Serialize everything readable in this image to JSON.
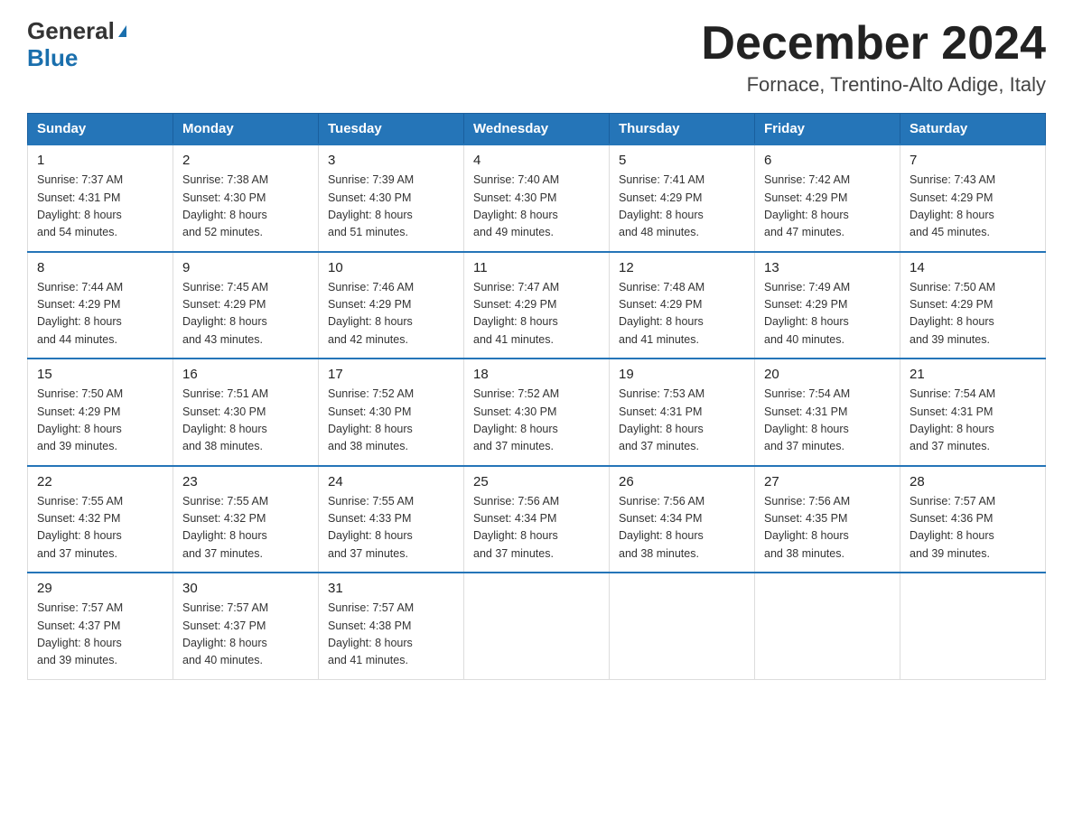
{
  "logo": {
    "line1": "General",
    "arrow": "▶",
    "line2": "Blue"
  },
  "title": {
    "month_year": "December 2024",
    "location": "Fornace, Trentino-Alto Adige, Italy"
  },
  "weekdays": [
    "Sunday",
    "Monday",
    "Tuesday",
    "Wednesday",
    "Thursday",
    "Friday",
    "Saturday"
  ],
  "weeks": [
    [
      {
        "day": "1",
        "sunrise": "7:37 AM",
        "sunset": "4:31 PM",
        "daylight": "8 hours and 54 minutes."
      },
      {
        "day": "2",
        "sunrise": "7:38 AM",
        "sunset": "4:30 PM",
        "daylight": "8 hours and 52 minutes."
      },
      {
        "day": "3",
        "sunrise": "7:39 AM",
        "sunset": "4:30 PM",
        "daylight": "8 hours and 51 minutes."
      },
      {
        "day": "4",
        "sunrise": "7:40 AM",
        "sunset": "4:30 PM",
        "daylight": "8 hours and 49 minutes."
      },
      {
        "day": "5",
        "sunrise": "7:41 AM",
        "sunset": "4:29 PM",
        "daylight": "8 hours and 48 minutes."
      },
      {
        "day": "6",
        "sunrise": "7:42 AM",
        "sunset": "4:29 PM",
        "daylight": "8 hours and 47 minutes."
      },
      {
        "day": "7",
        "sunrise": "7:43 AM",
        "sunset": "4:29 PM",
        "daylight": "8 hours and 45 minutes."
      }
    ],
    [
      {
        "day": "8",
        "sunrise": "7:44 AM",
        "sunset": "4:29 PM",
        "daylight": "8 hours and 44 minutes."
      },
      {
        "day": "9",
        "sunrise": "7:45 AM",
        "sunset": "4:29 PM",
        "daylight": "8 hours and 43 minutes."
      },
      {
        "day": "10",
        "sunrise": "7:46 AM",
        "sunset": "4:29 PM",
        "daylight": "8 hours and 42 minutes."
      },
      {
        "day": "11",
        "sunrise": "7:47 AM",
        "sunset": "4:29 PM",
        "daylight": "8 hours and 41 minutes."
      },
      {
        "day": "12",
        "sunrise": "7:48 AM",
        "sunset": "4:29 PM",
        "daylight": "8 hours and 41 minutes."
      },
      {
        "day": "13",
        "sunrise": "7:49 AM",
        "sunset": "4:29 PM",
        "daylight": "8 hours and 40 minutes."
      },
      {
        "day": "14",
        "sunrise": "7:50 AM",
        "sunset": "4:29 PM",
        "daylight": "8 hours and 39 minutes."
      }
    ],
    [
      {
        "day": "15",
        "sunrise": "7:50 AM",
        "sunset": "4:29 PM",
        "daylight": "8 hours and 39 minutes."
      },
      {
        "day": "16",
        "sunrise": "7:51 AM",
        "sunset": "4:30 PM",
        "daylight": "8 hours and 38 minutes."
      },
      {
        "day": "17",
        "sunrise": "7:52 AM",
        "sunset": "4:30 PM",
        "daylight": "8 hours and 38 minutes."
      },
      {
        "day": "18",
        "sunrise": "7:52 AM",
        "sunset": "4:30 PM",
        "daylight": "8 hours and 37 minutes."
      },
      {
        "day": "19",
        "sunrise": "7:53 AM",
        "sunset": "4:31 PM",
        "daylight": "8 hours and 37 minutes."
      },
      {
        "day": "20",
        "sunrise": "7:54 AM",
        "sunset": "4:31 PM",
        "daylight": "8 hours and 37 minutes."
      },
      {
        "day": "21",
        "sunrise": "7:54 AM",
        "sunset": "4:31 PM",
        "daylight": "8 hours and 37 minutes."
      }
    ],
    [
      {
        "day": "22",
        "sunrise": "7:55 AM",
        "sunset": "4:32 PM",
        "daylight": "8 hours and 37 minutes."
      },
      {
        "day": "23",
        "sunrise": "7:55 AM",
        "sunset": "4:32 PM",
        "daylight": "8 hours and 37 minutes."
      },
      {
        "day": "24",
        "sunrise": "7:55 AM",
        "sunset": "4:33 PM",
        "daylight": "8 hours and 37 minutes."
      },
      {
        "day": "25",
        "sunrise": "7:56 AM",
        "sunset": "4:34 PM",
        "daylight": "8 hours and 37 minutes."
      },
      {
        "day": "26",
        "sunrise": "7:56 AM",
        "sunset": "4:34 PM",
        "daylight": "8 hours and 38 minutes."
      },
      {
        "day": "27",
        "sunrise": "7:56 AM",
        "sunset": "4:35 PM",
        "daylight": "8 hours and 38 minutes."
      },
      {
        "day": "28",
        "sunrise": "7:57 AM",
        "sunset": "4:36 PM",
        "daylight": "8 hours and 39 minutes."
      }
    ],
    [
      {
        "day": "29",
        "sunrise": "7:57 AM",
        "sunset": "4:37 PM",
        "daylight": "8 hours and 39 minutes."
      },
      {
        "day": "30",
        "sunrise": "7:57 AM",
        "sunset": "4:37 PM",
        "daylight": "8 hours and 40 minutes."
      },
      {
        "day": "31",
        "sunrise": "7:57 AM",
        "sunset": "4:38 PM",
        "daylight": "8 hours and 41 minutes."
      },
      null,
      null,
      null,
      null
    ]
  ],
  "labels": {
    "sunrise": "Sunrise:",
    "sunset": "Sunset:",
    "daylight": "Daylight:"
  }
}
